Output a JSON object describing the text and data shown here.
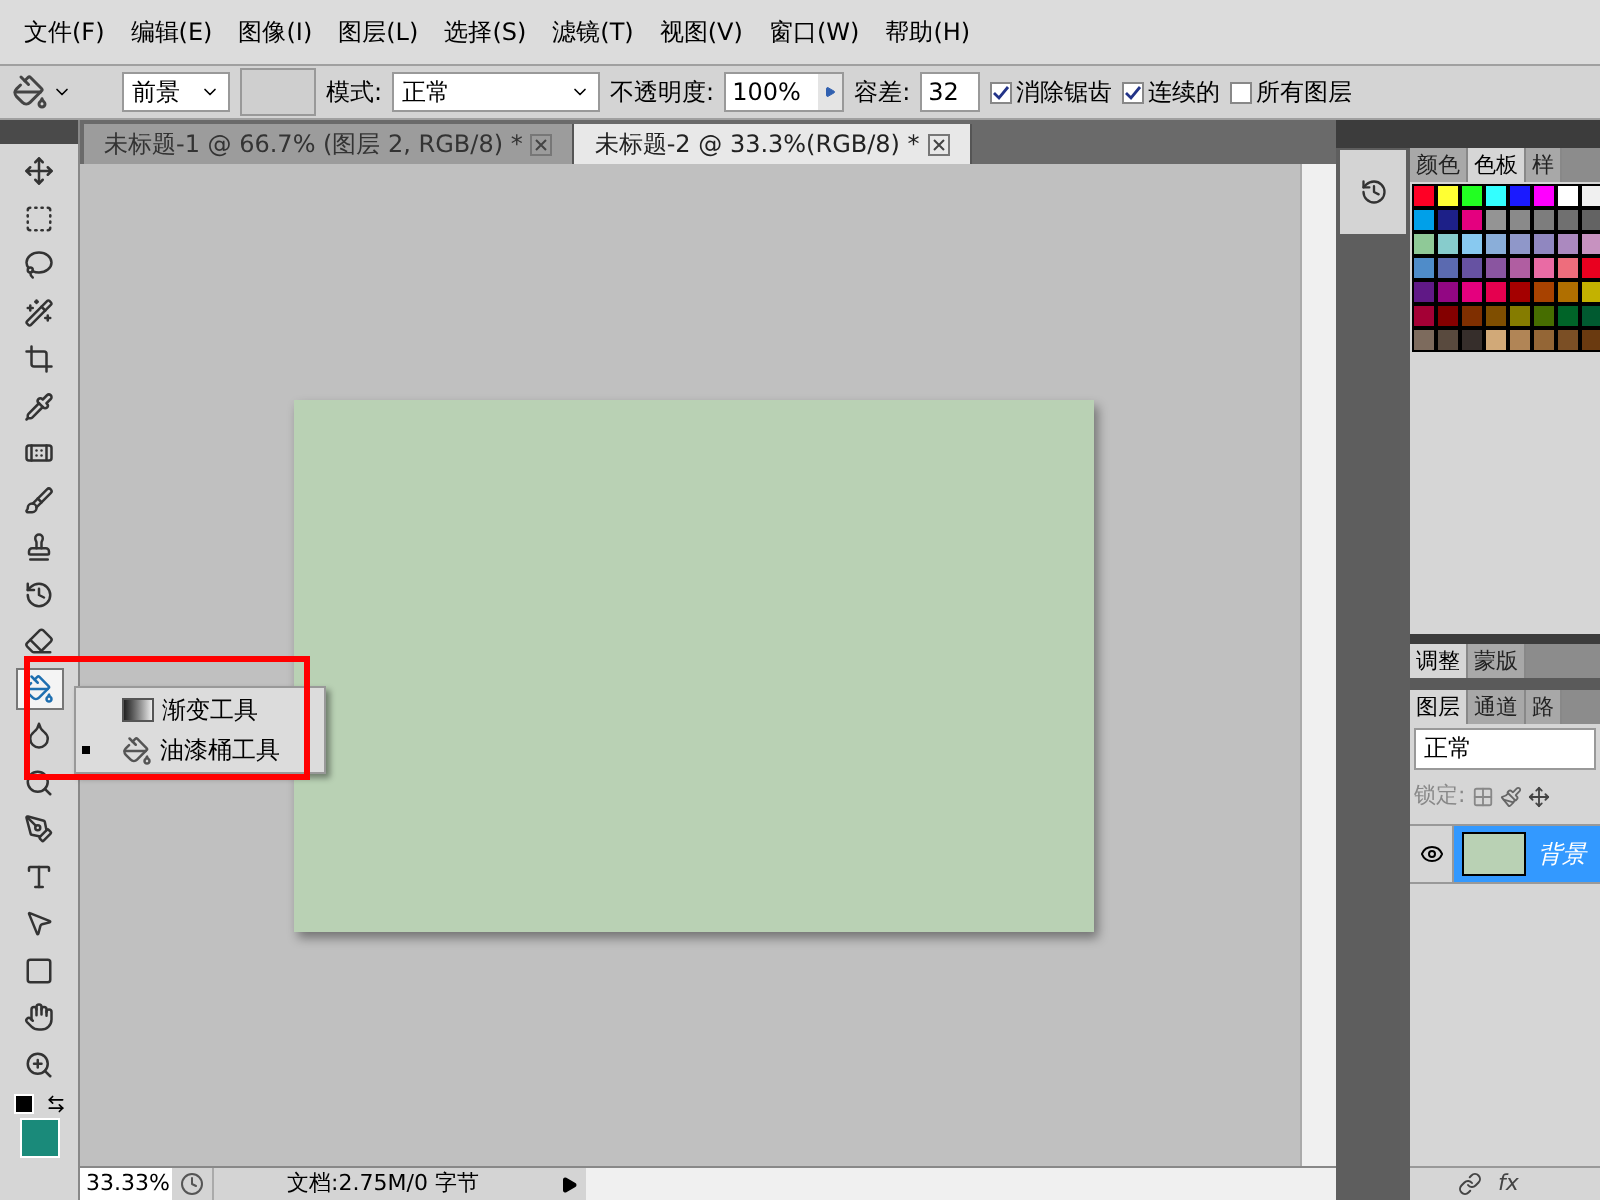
{
  "menu": [
    "文件(F)",
    "编辑(E)",
    "图像(I)",
    "图层(L)",
    "选择(S)",
    "滤镜(T)",
    "视图(V)",
    "窗口(W)",
    "帮助(H)"
  ],
  "options_bar": {
    "fill_source": "前景",
    "mode_label": "模式:",
    "mode": "正常",
    "opacity_label": "不透明度:",
    "opacity": "100%",
    "tolerance_label": "容差:",
    "tolerance": "32",
    "checkboxes": [
      {
        "label": "消除锯齿",
        "checked": true
      },
      {
        "label": "连续的",
        "checked": true
      },
      {
        "label": "所有图层",
        "checked": false
      }
    ]
  },
  "document_tabs": [
    {
      "label": "未标题-1 @ 66.7% (图层 2, RGB/8) *",
      "selected": false
    },
    {
      "label": "未标题-2 @ 33.3%(RGB/8) *",
      "selected": true
    }
  ],
  "tools": [
    {
      "kind": "move",
      "selected": false
    },
    {
      "kind": "marquee",
      "selected": false
    },
    {
      "kind": "lasso",
      "selected": false
    },
    {
      "kind": "quick-select",
      "selected": false
    },
    {
      "kind": "crop",
      "selected": false
    },
    {
      "kind": "eyedropper",
      "selected": false
    },
    {
      "kind": "healing",
      "selected": false
    },
    {
      "kind": "brush",
      "selected": false
    },
    {
      "kind": "stamp",
      "selected": false
    },
    {
      "kind": "history-brush",
      "selected": false
    },
    {
      "kind": "eraser",
      "selected": false
    },
    {
      "kind": "bucket",
      "selected": true
    },
    {
      "kind": "blur",
      "selected": false
    },
    {
      "kind": "dodge",
      "selected": false
    },
    {
      "kind": "pen",
      "selected": false
    },
    {
      "kind": "type",
      "selected": false
    },
    {
      "kind": "path-select",
      "selected": false
    },
    {
      "kind": "rectangle",
      "selected": false
    },
    {
      "kind": "hand",
      "selected": false
    },
    {
      "kind": "zoom",
      "selected": false
    }
  ],
  "foreground_color": {
    "color": "#1a8a7a"
  },
  "tool_flyout": [
    {
      "kind": "gradient",
      "label": "渐变工具",
      "selected": false
    },
    {
      "kind": "bucket",
      "label": "油漆桶工具",
      "selected": true
    }
  ],
  "status_bar": {
    "zoom": "33.33%",
    "info": "文档:2.75M/0 字节"
  },
  "swatch_panel": {
    "tabs": [
      {
        "label": "颜色",
        "selected": false
      },
      {
        "label": "色板",
        "selected": true
      },
      {
        "label": "样",
        "selected": false
      }
    ],
    "swatches": [
      {
        "color": "#ff0025"
      },
      {
        "color": "#ffff33"
      },
      {
        "color": "#22ff22"
      },
      {
        "color": "#33ffff"
      },
      {
        "color": "#1a1aff"
      },
      {
        "color": "#ff00ff"
      },
      {
        "color": "#ffffff"
      },
      {
        "color": "#f0f0f0"
      },
      {
        "color": "#00a0e9"
      },
      {
        "color": "#1d2088"
      },
      {
        "color": "#e4007f"
      },
      {
        "color": "#949494"
      },
      {
        "color": "#8a8a8a"
      },
      {
        "color": "#7d7d7d"
      },
      {
        "color": "#707070"
      },
      {
        "color": "#636363"
      },
      {
        "color": "#8fc997"
      },
      {
        "color": "#87cccc"
      },
      {
        "color": "#88c9f0"
      },
      {
        "color": "#8aaed9"
      },
      {
        "color": "#8f97c9"
      },
      {
        "color": "#9087c0"
      },
      {
        "color": "#ab89bf"
      },
      {
        "color": "#c792c0"
      },
      {
        "color": "#4f8cc9"
      },
      {
        "color": "#5b6ab0"
      },
      {
        "color": "#6652a2"
      },
      {
        "color": "#8a55a0"
      },
      {
        "color": "#b05ea1"
      },
      {
        "color": "#e96ba4"
      },
      {
        "color": "#ee6d7c"
      },
      {
        "color": "#e9001f"
      },
      {
        "color": "#601986"
      },
      {
        "color": "#920783"
      },
      {
        "color": "#e4007e"
      },
      {
        "color": "#e5004f"
      },
      {
        "color": "#a40000"
      },
      {
        "color": "#a84200"
      },
      {
        "color": "#b06f00"
      },
      {
        "color": "#c3b200"
      },
      {
        "color": "#a40035"
      },
      {
        "color": "#840000"
      },
      {
        "color": "#7f2f00"
      },
      {
        "color": "#7f4e00"
      },
      {
        "color": "#857c00"
      },
      {
        "color": "#466d00"
      },
      {
        "color": "#006428"
      },
      {
        "color": "#005a30"
      },
      {
        "color": "#7d6b5d"
      },
      {
        "color": "#594a3e"
      },
      {
        "color": "#362e2b"
      },
      {
        "color": "#d1a978"
      },
      {
        "color": "#b18556"
      },
      {
        "color": "#946636"
      },
      {
        "color": "#7b4f25"
      },
      {
        "color": "#6a3a10"
      }
    ]
  },
  "adjust_panel": {
    "tabs": [
      {
        "label": "调整",
        "selected": true
      },
      {
        "label": "蒙版",
        "selected": false
      }
    ]
  },
  "layers_panel": {
    "tabs": [
      {
        "label": "图层",
        "selected": true
      },
      {
        "label": "通道",
        "selected": false
      },
      {
        "label": "路",
        "selected": false
      }
    ],
    "blend_mode": "正常",
    "lock_label": "锁定:",
    "layers": [
      {
        "name": "背景",
        "selected": true,
        "visible": true,
        "color": "#b9d1b4"
      }
    ],
    "fx": "fx"
  }
}
